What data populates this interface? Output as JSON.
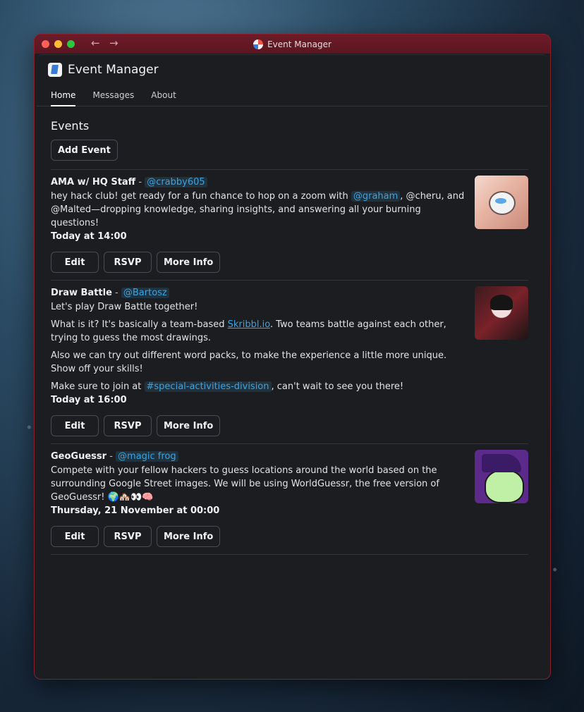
{
  "window": {
    "title": "Event Manager"
  },
  "app": {
    "title": "Event Manager"
  },
  "tabs": [
    {
      "label": "Home",
      "active": true
    },
    {
      "label": "Messages",
      "active": false
    },
    {
      "label": "About",
      "active": false
    }
  ],
  "events_section": {
    "title": "Events",
    "add_button": "Add Event"
  },
  "events": [
    {
      "name": "AMA w/ HQ Staff",
      "separator": " - ",
      "host": "@crabby605",
      "desc_part1": "hey hack club! get ready for a fun chance to hop on a zoom with ",
      "desc_mention": "@graham",
      "desc_part2": ", @cheru, and @Malted—dropping knowledge, sharing insights, and answering all your burning questions!",
      "when": "Today at 14:00",
      "edit": "Edit",
      "rsvp": "RSVP",
      "more": "More Info",
      "image": "cat-thumbnail"
    },
    {
      "name": "Draw Battle",
      "separator": " - ",
      "host": "@Bartosz",
      "line1": "Let's play Draw Battle together!",
      "line2_a": "What is it? It's basically a team-based ",
      "line2_link": "Skribbl.io",
      "line2_b": ". Two teams battle against each other, trying to guess the most drawings.",
      "line3": "Also we can try out different word packs, to make the experience a little more unique. Show off your skills!",
      "line4_a": "Make sure to join at ",
      "line4_channel": "#special-activities-division",
      "line4_b": ", can't wait to see you there!",
      "when": "Today at 16:00",
      "edit": "Edit",
      "rsvp": "RSVP",
      "more": "More Info",
      "image": "anime-thumbnail"
    },
    {
      "name": "GeoGuessr",
      "separator": " - ",
      "host": "@magic frog",
      "desc": "Compete with your fellow hackers to guess locations around the world based on the surrounding Google Street images. We will be using WorldGuessr, the free version of GeoGuessr! 🌍🏘️👀🧠",
      "when": "Thursday, 21 November at 00:00",
      "edit": "Edit",
      "rsvp": "RSVP",
      "more": "More Info",
      "image": "frog-thumbnail"
    }
  ],
  "colors": {
    "window_bg": "#1c1d21",
    "titlebar": "#6e1b28",
    "mention": "#3ea3e0"
  }
}
